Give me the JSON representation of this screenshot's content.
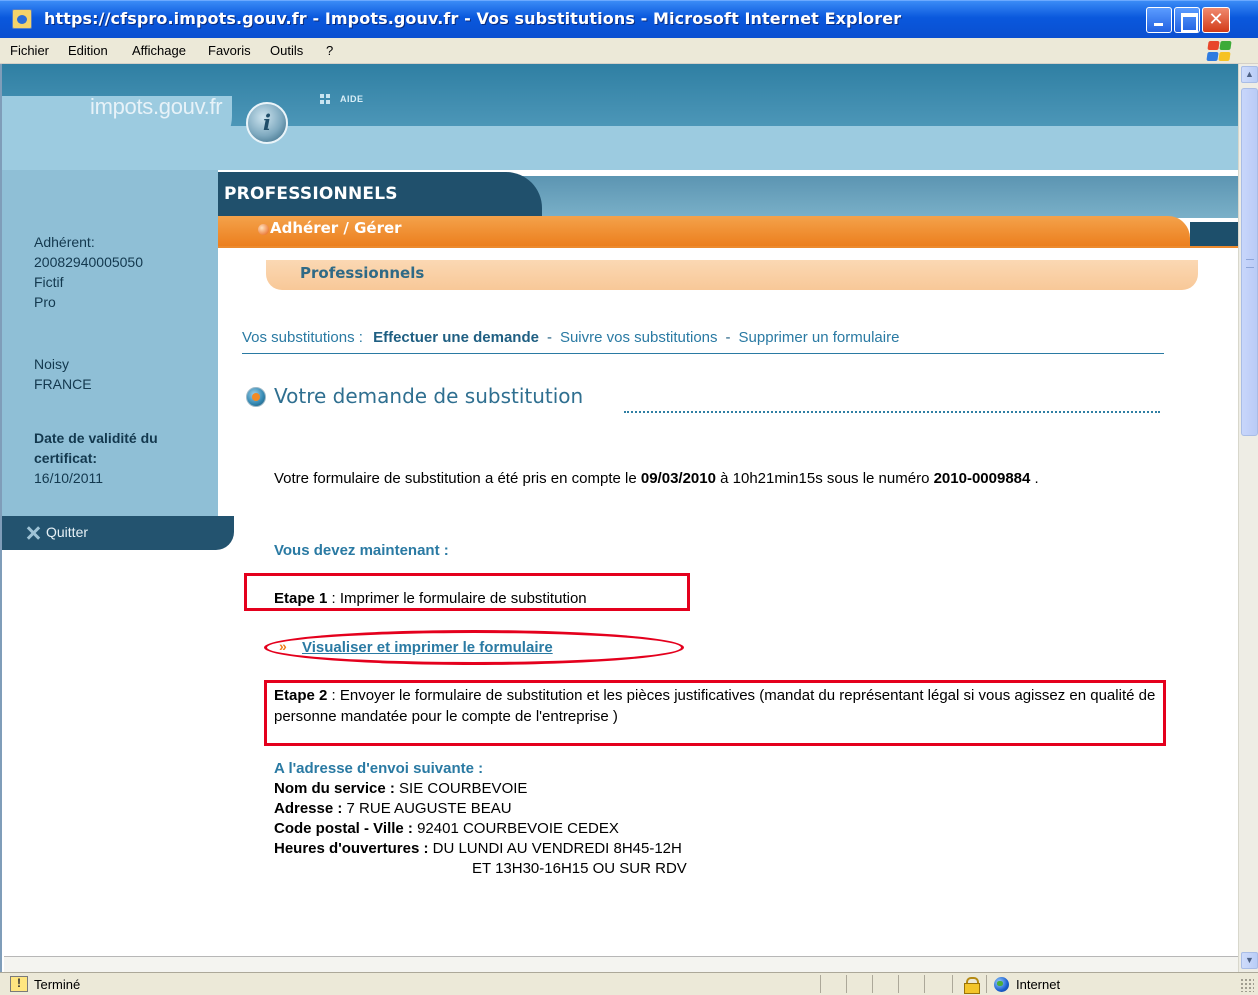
{
  "window": {
    "title": "https://cfspro.impots.gouv.fr - Impots.gouv.fr - Vos substitutions - Microsoft Internet Explorer",
    "close_glyph": "✕"
  },
  "menu": [
    "Fichier",
    "Edition",
    "Affichage",
    "Favoris",
    "Outils",
    "?"
  ],
  "header": {
    "logo_text": "impots.gouv.fr",
    "logo_letter": "i",
    "aide": "AIDE",
    "section_title": "PROFESSIONNELS",
    "nav_label": "Adhérer / Gérer",
    "sub_title": "Professionnels"
  },
  "sidebar": {
    "adherent_label": "Adhérent:",
    "adherent_number": "20082940005050",
    "name_line1": "Fictif",
    "name_line2": "Pro",
    "city": "Noisy",
    "country": "FRANCE",
    "validity_label_line1": "Date de validité du",
    "validity_label_line2": "certificat:",
    "validity_date": "16/10/2011",
    "quit": "Quitter"
  },
  "breadcrumb": {
    "prefix": "Vos substitutions :",
    "current": "Effectuer une demande",
    "link2": "Suivre vos substitutions",
    "link3": "Supprimer un formulaire",
    "separator": "-"
  },
  "main": {
    "heading": "Votre demande de substitution",
    "confirm_before_date": "Votre formulaire de substitution a été pris en compte le ",
    "confirm_date": "09/03/2010",
    "confirm_time_text": " à 10h21min15s sous le numéro ",
    "confirm_number": "2010-0009884",
    "confirm_end": " .",
    "must_now": "Vous devez maintenant :",
    "step1_label": "Etape 1",
    "step1_text": " : Imprimer le formulaire de substitution",
    "link_chevron": "»",
    "link_label": "Visualiser et imprimer le formulaire",
    "step2_label": "Etape 2",
    "step2_text": " : Envoyer le formulaire de substitution et les pièces justificatives (mandat du représentant légal si vous agissez en qualité de personne mandatée pour le compte de l'entreprise )",
    "address_heading": "A l'adresse d'envoi suivante :",
    "service_label": "Nom du service :",
    "service_value": " SIE COURBEVOIE",
    "address_label": "Adresse :",
    "address_value": " 7 RUE AUGUSTE BEAU",
    "postal_label": "Code postal - Ville :",
    "postal_value": " 92401 COURBEVOIE CEDEX",
    "hours_label": "Heures d'ouvertures :",
    "hours_value_line1": " DU LUNDI AU VENDREDI 8H45-12H",
    "hours_value_line2": "ET 13H30-16H15 OU SUR RDV"
  },
  "statusbar": {
    "status": "Terminé",
    "zone": "Internet"
  },
  "colors": {
    "accent_blue": "#2a7aa3",
    "orange": "#ec7f1e",
    "highlight_red": "#e4001d",
    "titlebar_blue": "#0a58dd"
  },
  "icons": [
    "ie-page-icon",
    "minimize-icon",
    "maximize-icon",
    "close-icon",
    "windows-logo-icon",
    "scroll-up-icon",
    "scroll-down-icon",
    "quit-icon",
    "section-icon",
    "chevron-icon",
    "warning-icon",
    "lock-icon",
    "globe-icon"
  ]
}
